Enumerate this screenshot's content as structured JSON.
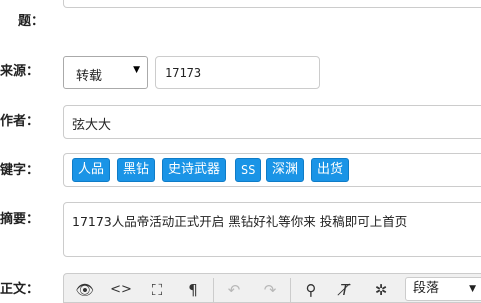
{
  "form": {
    "title_label": "题：",
    "source_label": "来源：",
    "source_select": "转载",
    "source_input": "17173",
    "author_label": "作者：",
    "author_value": "弦大大",
    "keywords_label": "键字：",
    "keywords": [
      "人品",
      "黑钻",
      "史诗武器",
      "SS",
      "深渊",
      "出货"
    ],
    "summary_label": "摘要：",
    "summary_value": "17173人品帝活动正式开启 黑钻好礼等你来 投稿即可上首页",
    "body_label": "正文："
  },
  "editor_toolbar": {
    "buttons": [
      {
        "name": "preview-eye-icon",
        "glyph": "👁"
      },
      {
        "name": "source-code-icon",
        "glyph": "‹›"
      },
      {
        "name": "fullscreen-icon",
        "glyph": "⛶"
      },
      {
        "name": "paragraph-mark-icon",
        "glyph": "¶"
      },
      {
        "name": "undo-icon",
        "glyph": "↶"
      },
      {
        "name": "redo-icon",
        "glyph": "↷"
      },
      {
        "name": "find-binoculars-icon",
        "glyph": "⚲"
      },
      {
        "name": "clear-format-icon",
        "glyph": "T̸"
      },
      {
        "name": "magic-wand-icon",
        "glyph": "✲"
      }
    ],
    "paragraph_select": "段落"
  },
  "colors": {
    "tag_bg": "#1a94e6",
    "tag_border": "#0f7cc7"
  }
}
